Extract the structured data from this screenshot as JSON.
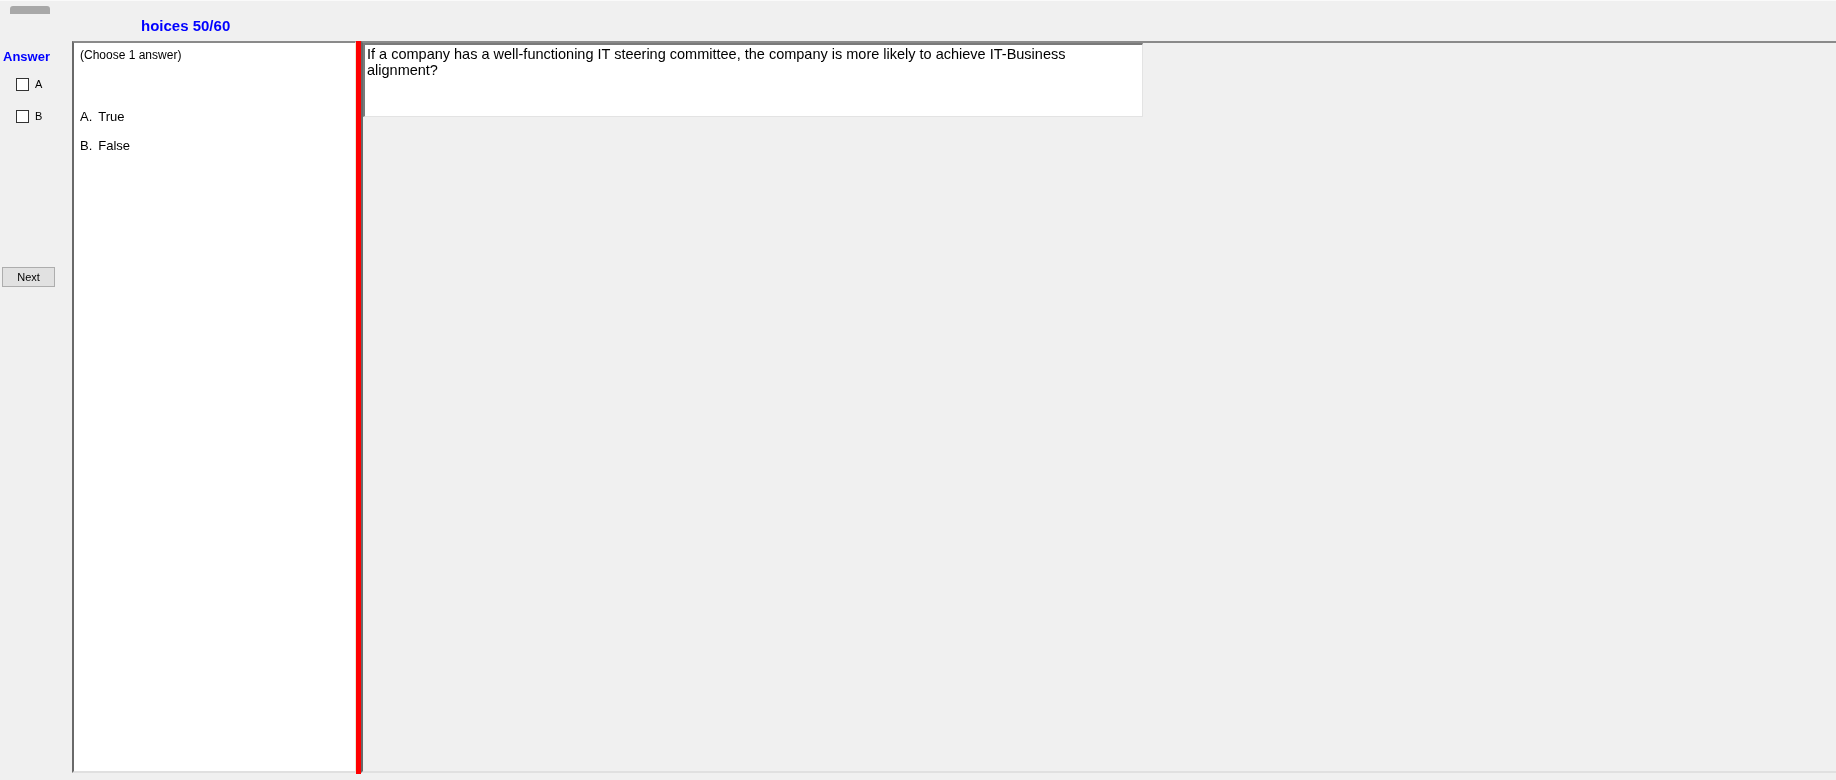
{
  "header": {
    "title": "hoices 50/60"
  },
  "answer_panel": {
    "title": "Answer",
    "options": [
      {
        "label": "A",
        "checked": false
      },
      {
        "label": "B",
        "checked": false
      }
    ],
    "next_button": "Next"
  },
  "choices_panel": {
    "instruction": "(Choose 1 answer)",
    "choices": [
      {
        "letter": "A.",
        "text": "True"
      },
      {
        "letter": "B.",
        "text": "False"
      }
    ]
  },
  "question": {
    "text": "If a company has a well-functioning IT steering committee, the company is more likely to achieve IT-Business alignment?"
  }
}
